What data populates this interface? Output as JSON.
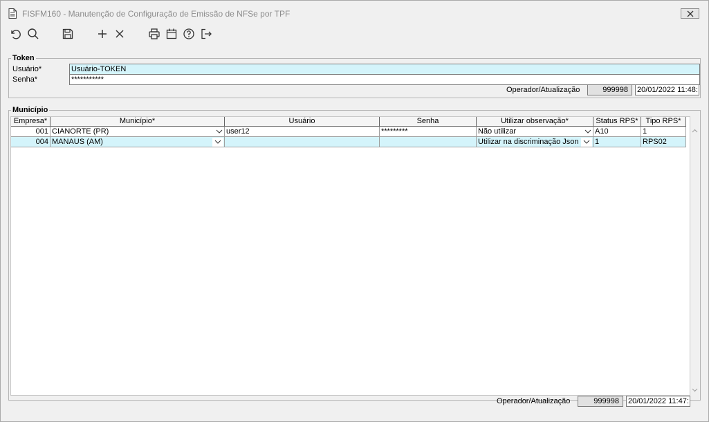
{
  "window": {
    "title": "FISFM160 - Manutenção de Configuração de Emissão de NFSe por TPF"
  },
  "toolbar": {
    "icons": [
      "undo-icon",
      "search-icon",
      "save-icon",
      "add-icon",
      "delete-icon",
      "print-icon",
      "calendar-icon",
      "help-icon",
      "exit-icon"
    ]
  },
  "token": {
    "legend": "Token",
    "usuario_label": "Usuário*",
    "usuario_value": "Usuário-TOKEN",
    "senha_label": "Senha*",
    "senha_value": "***********",
    "operador_label": "Operador/Atualização",
    "operador_value": "999998",
    "data_value": "20/01/2022 11:48:"
  },
  "municipio": {
    "legend": "Município",
    "columns": [
      "Empresa*",
      "Município*",
      "Usuário",
      "Senha",
      "Utilizar observação*",
      "Status RPS*",
      "Tipo RPS*"
    ],
    "rows": [
      {
        "empresa": "001",
        "municipio": "CIANORTE (PR)",
        "usuario": "user12",
        "senha": "*********",
        "observacao": "Não utilizar",
        "status": "A10",
        "tipo": "1"
      },
      {
        "empresa": "004",
        "municipio": "MANAUS (AM)",
        "usuario": "",
        "senha": "",
        "observacao": "Utilizar na discriminação Json",
        "status": "1",
        "tipo": "RPS02"
      }
    ],
    "operador_label": "Operador/Atualização",
    "operador_value": "999998",
    "data_value": "20/01/2022 11:47:"
  },
  "colors": {
    "highlight": "#d4f4fb",
    "readonly": "#e1e1e1"
  }
}
